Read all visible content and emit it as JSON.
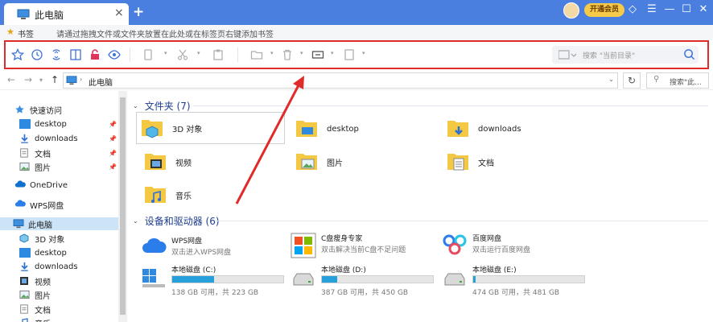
{
  "window": {
    "tab_title": "此电脑",
    "close_tab_glyph": "×",
    "new_tab_glyph": "+",
    "vip_label": "开通会员",
    "controls": [
      "◇",
      "☰",
      "—",
      "☐",
      "✕"
    ]
  },
  "bookmark_bar": {
    "label": "书签",
    "hint": "请通过拖拽文件或文件夹放置在此处或在标签页右键添加书签"
  },
  "toolbar": {
    "icons": [
      "star-icon",
      "clock-icon",
      "sync-icon",
      "split-view-icon",
      "lock-icon",
      "eye-icon",
      "copy-icon",
      "cut-icon",
      "paste-icon",
      "new-folder-icon",
      "delete-icon",
      "rename-icon",
      "properties-icon"
    ],
    "search_placeholder": "搜索 \"当前目录\""
  },
  "address_bar": {
    "path": "此电脑",
    "search_placeholder": "搜索\"此...",
    "refresh_glyph": "↻"
  },
  "sidebar": {
    "quick_access": "快速访问",
    "quick_items": [
      "desktop",
      "downloads",
      "文档",
      "图片"
    ],
    "onedrive": "OneDrive",
    "wps": "WPS网盘",
    "this_pc": "此电脑",
    "pc_items": [
      "3D 对象",
      "desktop",
      "downloads",
      "视频",
      "图片",
      "文档",
      "音乐"
    ]
  },
  "main": {
    "folders_header": "文件夹 (7)",
    "folders": [
      "3D 对象",
      "desktop",
      "downloads",
      "视频",
      "图片",
      "文档",
      "音乐"
    ],
    "devices_header": "设备和驱动器 (6)",
    "apps": [
      {
        "name": "WPS网盘",
        "sub": "双击进入WPS网盘"
      },
      {
        "name": "C盘瘦身专家",
        "sub": "双击解决当前C盘不足问题"
      },
      {
        "name": "百度网盘",
        "sub": "双击运行百度网盘"
      }
    ],
    "drives": [
      {
        "name": "本地磁盘 (C:)",
        "free": "138 GB 可用，共 223 GB",
        "used_fraction": 0.38
      },
      {
        "name": "本地磁盘 (D:)",
        "free": "387 GB 可用，共 450 GB",
        "used_fraction": 0.14
      },
      {
        "name": "本地磁盘 (E:)",
        "free": "474 GB 可用，共 481 GB",
        "used_fraction": 0.02
      }
    ]
  },
  "colors": {
    "titlebar": "#4a7fe0",
    "highlight": "#e02b2b",
    "drive_fill": "#26a0da",
    "folder": "#f5c843"
  }
}
